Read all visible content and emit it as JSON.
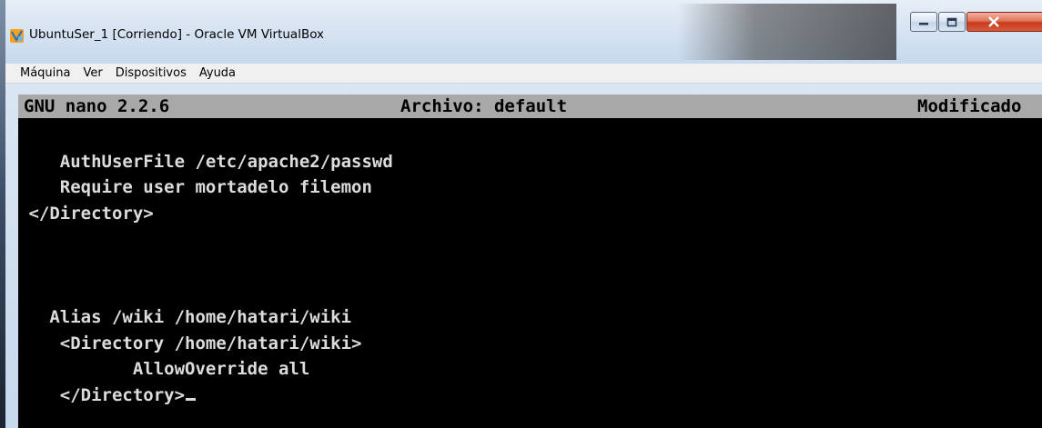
{
  "window": {
    "title": "UbuntuSer_1 [Corriendo] - Oracle VM VirtualBox"
  },
  "menu": {
    "items": [
      "Máquina",
      "Ver",
      "Dispositivos",
      "Ayuda"
    ]
  },
  "nano": {
    "version": "GNU nano 2.2.6",
    "file": "Archivo: default",
    "status": "Modificado"
  },
  "editor": {
    "lines": [
      "    AuthUserFile /etc/apache2/passwd",
      "    Require user mortadelo filemon",
      " </Directory>",
      "   Alias /wiki /home/hatari/wiki",
      "    <Directory /home/hatari/wiki>",
      "           AllowOverride all",
      "    </Directory>"
    ]
  },
  "colors": {
    "terminal_bg": "#000000",
    "terminal_fg": "#dcdcdc",
    "nano_bar_bg": "#a8a8a8"
  }
}
